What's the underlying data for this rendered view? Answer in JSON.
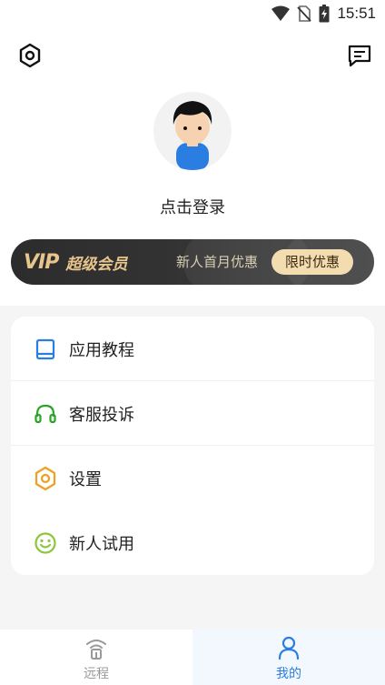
{
  "status_bar": {
    "time": "15:51",
    "icons": [
      "wifi-icon",
      "no-sim-icon",
      "battery-charging-icon"
    ]
  },
  "header": {
    "left_icon": "hexagon-settings-icon",
    "right_icon": "message-icon"
  },
  "profile": {
    "login_text": "点击登录",
    "avatar_icon": "avatar-boy-icon"
  },
  "vip_banner": {
    "vip_word": "VIP",
    "title": "超级会员",
    "promo_text": "新人首月优惠",
    "badge": "限时优惠"
  },
  "menu": {
    "items": [
      {
        "label": "应用教程",
        "icon": "book-icon",
        "color": "#2a7de1"
      },
      {
        "label": "客服投诉",
        "icon": "headset-icon",
        "color": "#2aa52a"
      },
      {
        "label": "设置",
        "icon": "hexagon-settings-icon",
        "color": "#f0a020"
      },
      {
        "label": "新人试用",
        "icon": "smiley-icon",
        "color": "#8cc63f"
      }
    ]
  },
  "tabbar": {
    "tabs": [
      {
        "label": "远程",
        "icon": "remote-signal-icon",
        "active": false,
        "color": "#999999"
      },
      {
        "label": "我的",
        "icon": "person-icon",
        "active": true,
        "color": "#2a7de1"
      }
    ]
  }
}
